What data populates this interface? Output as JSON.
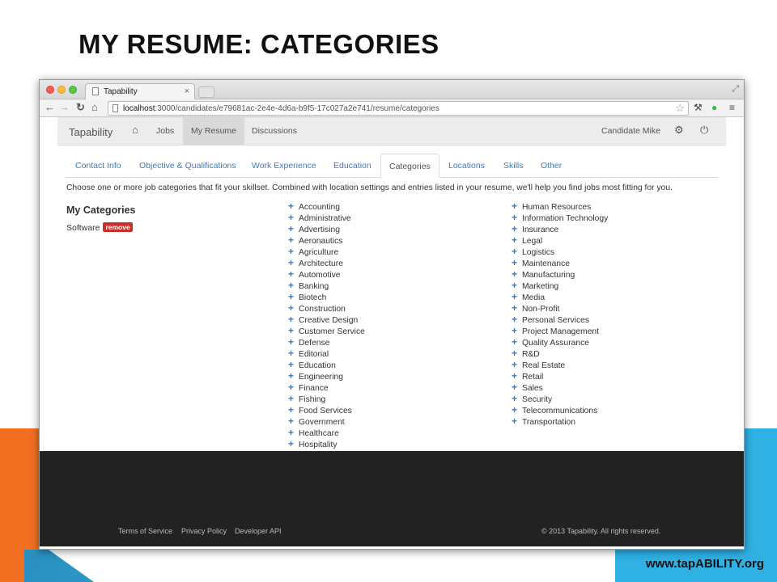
{
  "slide": {
    "title": "MY RESUME: CATEGORIES",
    "footer_url": "www.tapABILITY.org"
  },
  "browser": {
    "tab_title": "Tapability",
    "tab_close": "×",
    "url_host": "localhost",
    "url_path": ":3000/candidates/e79681ac-2e4e-4d6a-b9f5-17c027a2e741/resume/categories"
  },
  "navbar": {
    "brand": "Tapability",
    "links": [
      "Jobs",
      "My Resume",
      "Discussions"
    ],
    "user": "Candidate Mike"
  },
  "tabs": [
    "Contact Info",
    "Objective & Qualifications",
    "Work Experience",
    "Education",
    "Categories",
    "Locations",
    "Skills",
    "Other"
  ],
  "intro": "Choose one or more job categories that fit your skillset. Combined with location settings and entries listed in your resume, we'll help you find jobs most fitting for you.",
  "my_categories": {
    "title": "My Categories",
    "selected": "Software",
    "remove_label": "remove"
  },
  "categories_col1": [
    "Accounting",
    "Administrative",
    "Advertising",
    "Aeronautics",
    "Agriculture",
    "Architecture",
    "Automotive",
    "Banking",
    "Biotech",
    "Construction",
    "Creative Design",
    "Customer Service",
    "Defense",
    "Editorial",
    "Education",
    "Engineering",
    "Finance",
    "Fishing",
    "Food Services",
    "Government",
    "Healthcare",
    "Hospitality"
  ],
  "categories_col2": [
    "Human Resources",
    "Information Technology",
    "Insurance",
    "Legal",
    "Logistics",
    "Maintenance",
    "Manufacturing",
    "Marketing",
    "Media",
    "Non-Profit",
    "Personal Services",
    "Project Management",
    "Quality Assurance",
    "R&D",
    "Real Estate",
    "Retail",
    "Sales",
    "Security",
    "Telecommunications",
    "Transportation"
  ],
  "footer": {
    "links": [
      "Terms of Service",
      "Privacy Policy",
      "Developer API"
    ],
    "copyright": "© 2013 Tapability. All rights reserved."
  },
  "colors": {
    "link": "#3a7bbf",
    "remove_badge": "#c9302c",
    "footer_bg": "#222222",
    "accent_orange": "#f26f21",
    "accent_blue": "#2fb1e3"
  },
  "icons": [
    "home-icon",
    "gear-icon",
    "power-icon",
    "plus-icon",
    "star-icon",
    "wrench-icon",
    "menu-icon"
  ]
}
